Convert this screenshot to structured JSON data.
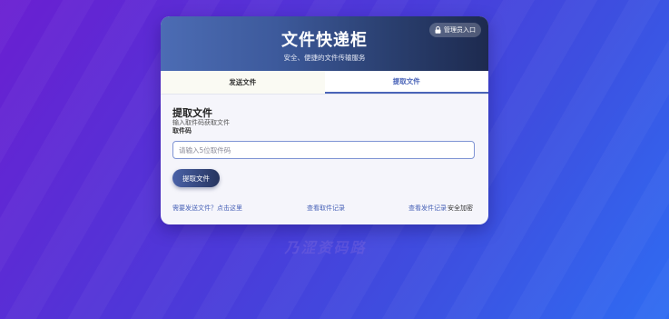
{
  "header": {
    "title": "文件快递柜",
    "subtitle": "安全、便捷的文件传输服务",
    "admin_label": "管理员入口"
  },
  "tabs": [
    {
      "label": "发送文件",
      "active": false
    },
    {
      "label": "提取文件",
      "active": true
    }
  ],
  "retrieve": {
    "title": "提取文件",
    "description": "输入取件码获取文件",
    "field_label": "取件码",
    "placeholder": "请输入5位取件码",
    "value": "",
    "button_label": "提取文件"
  },
  "footer": {
    "send_link": "需要发送文件？点击这里",
    "pickup_records": "查看取件记录",
    "send_records": "查看发件记录",
    "secure_label": "安全加密"
  },
  "watermark": "乃涩资码路",
  "colors": {
    "accent": "#4a64b8",
    "header_dark": "#1d2a4f",
    "header_light": "#4c6cb4"
  },
  "icons": {
    "admin": "lock-icon"
  }
}
